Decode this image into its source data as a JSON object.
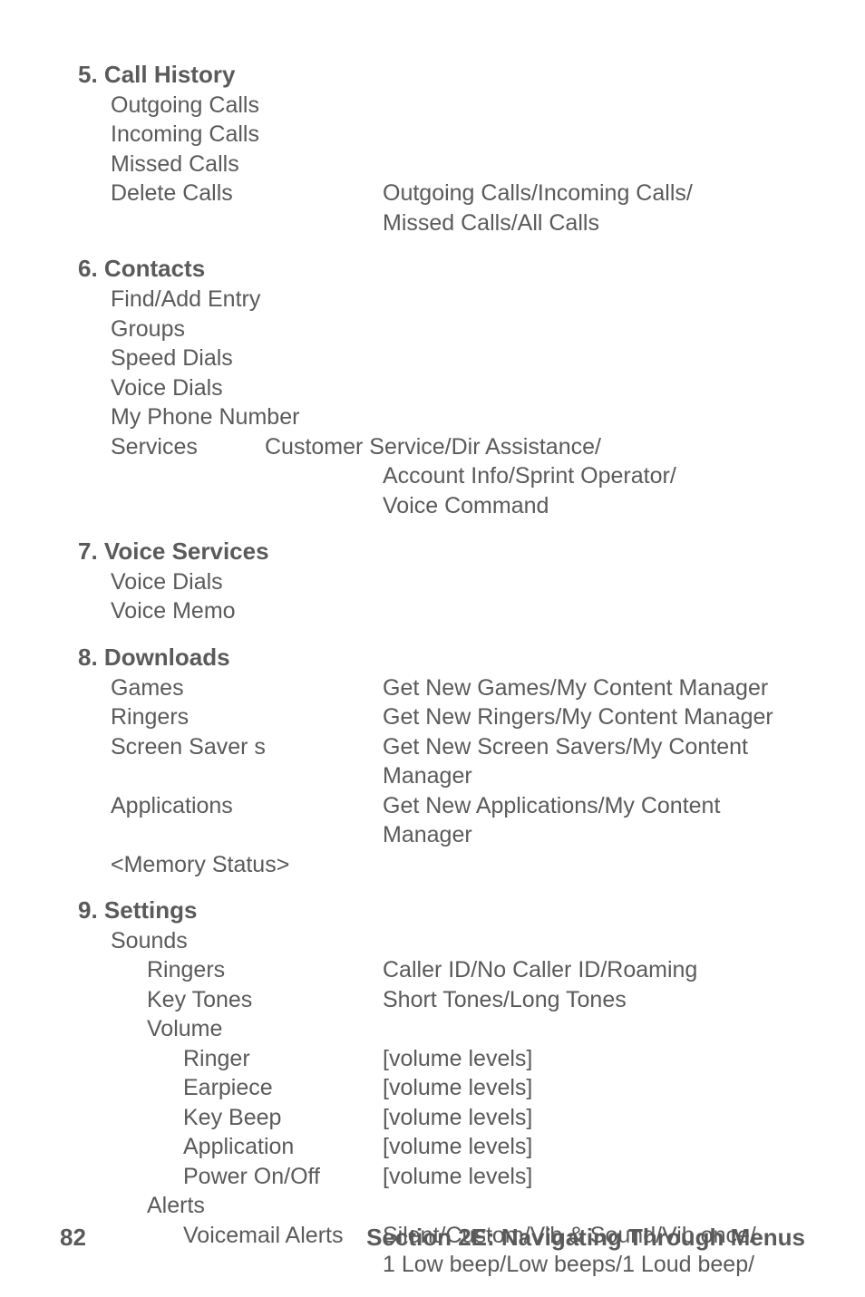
{
  "sections": [
    {
      "number": "5.",
      "title": "Call History",
      "rows": [
        {
          "label": "Outgoing Calls",
          "value": ""
        },
        {
          "label": "Incoming Calls",
          "value": ""
        },
        {
          "label": "Missed Calls",
          "value": ""
        },
        {
          "label": "Delete Calls",
          "value": "Outgoing Calls/Incoming Calls/"
        },
        {
          "label": "",
          "value": "Missed Calls/All Calls"
        }
      ]
    },
    {
      "number": "6.",
      "title": "Contacts",
      "rows": [
        {
          "label": "Find/Add Entry",
          "value": ""
        },
        {
          "label": "Groups",
          "value": ""
        },
        {
          "label": "Speed Dials",
          "value": ""
        },
        {
          "label": "Voice Dials",
          "value": ""
        },
        {
          "label": "My Phone Number",
          "value": ""
        },
        {
          "label": "Services",
          "value": "Customer Service/Dir Assistance/",
          "narrow": true
        },
        {
          "label": "",
          "value": "Account Info/Sprint Operator/"
        },
        {
          "label": "",
          "value": "Voice Command"
        }
      ]
    },
    {
      "number": "7.",
      "title": "Voice Services",
      "rows": [
        {
          "label": "Voice Dials",
          "value": ""
        },
        {
          "label": "Voice Memo",
          "value": ""
        }
      ]
    },
    {
      "number": "8.",
      "title": "Downloads",
      "rows": [
        {
          "label": "Games",
          "value": "Get New Games/My Content Manager"
        },
        {
          "label": "Ringers",
          "value": "Get New Ringers/My Content Manager"
        },
        {
          "label": "Screen Saver s",
          "value": "Get New Screen Savers/My Content"
        },
        {
          "label": "",
          "value": "Manager"
        },
        {
          "label": "Applications",
          "value": "Get New Applications/My Content"
        },
        {
          "label": "",
          "value": "Manager"
        },
        {
          "label": "<Memory Status>",
          "value": ""
        }
      ]
    },
    {
      "number": "9.",
      "title": "Settings",
      "rows": [
        {
          "label": "Sounds",
          "value": ""
        },
        {
          "label": "Ringers",
          "value": "Caller ID/No Caller ID/Roaming",
          "indent": 1
        },
        {
          "label": "Key Tones",
          "value": "Short Tones/Long Tones",
          "indent": 1
        },
        {
          "label": "Volume",
          "value": "",
          "indent": 1
        },
        {
          "label": "Ringer",
          "value": "[volume levels]",
          "indent": 2
        },
        {
          "label": "Earpiece",
          "value": "[volume levels]",
          "indent": 2
        },
        {
          "label": "Key Beep",
          "value": "[volume levels]",
          "indent": 2
        },
        {
          "label": "Application",
          "value": "[volume levels]",
          "indent": 2
        },
        {
          "label": "Power On/Off",
          "value": "[volume levels]",
          "indent": 2
        },
        {
          "label": "Alerts",
          "value": "",
          "indent": 1
        },
        {
          "label": "Voicemail Alerts",
          "value": "Silent/Custom/Vib & Sound/Vib once/",
          "indent": 2
        },
        {
          "label": "",
          "value": "1 Low beep/Low beeps/1 Loud beep/",
          "indent": 2,
          "valuePadLeft": true
        }
      ]
    }
  ],
  "footer": {
    "page": "82",
    "title": "Section 2E: Navigating Through Menus"
  }
}
